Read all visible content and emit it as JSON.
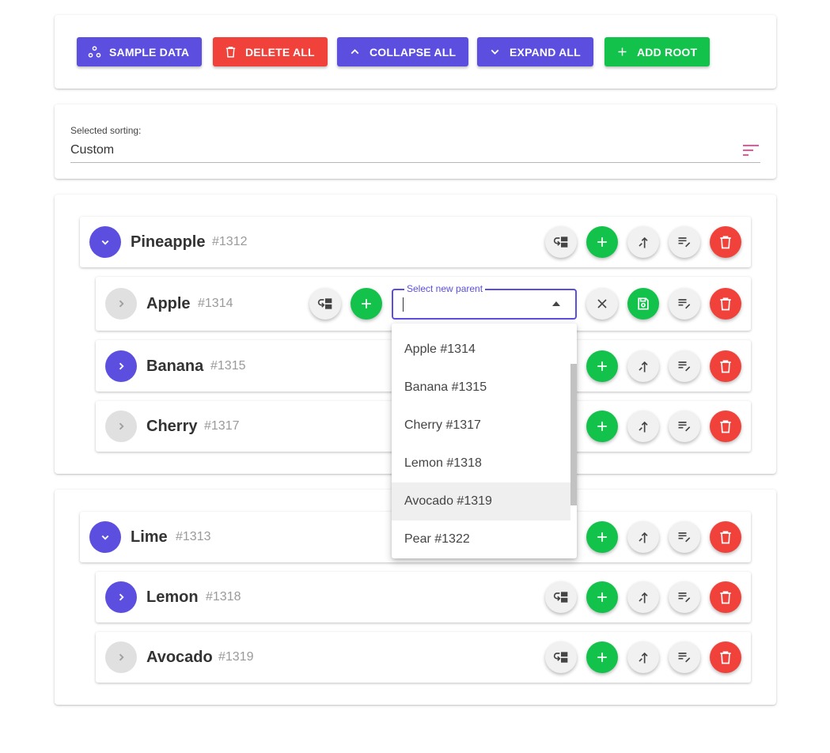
{
  "toolbar": {
    "buttons": [
      {
        "label": "SAMPLE DATA",
        "icon": "sample-data-icon",
        "color": "#5c4fe0"
      },
      {
        "label": "DELETE ALL",
        "icon": "trash-icon",
        "color": "#f0413b"
      },
      {
        "label": "COLLAPSE ALL",
        "icon": "chevron-up-icon",
        "color": "#5c4fe0"
      },
      {
        "label": "EXPAND ALL",
        "icon": "chevron-down-icon",
        "color": "#5c4fe0"
      },
      {
        "label": "ADD ROOT",
        "icon": "plus-icon",
        "color": "#13c24b"
      }
    ]
  },
  "sorting": {
    "label": "Selected sorting:",
    "value": "Custom"
  },
  "tree1": {
    "root": {
      "name": "Pineapple",
      "id": "#1312",
      "expanded": true
    },
    "children": [
      {
        "name": "Apple",
        "id": "#1314",
        "expanded": false
      },
      {
        "name": "Banana",
        "id": "#1315",
        "expanded": false
      },
      {
        "name": "Cherry",
        "id": "#1317",
        "expanded": false
      }
    ]
  },
  "tree2": {
    "root": {
      "name": "Lime",
      "id": "#1313",
      "expanded": true
    },
    "children": [
      {
        "name": "Lemon",
        "id": "#1318",
        "expanded": false
      },
      {
        "name": "Avocado",
        "id": "#1319",
        "expanded": false
      }
    ]
  },
  "parent_select": {
    "label": "Select new parent",
    "value": "",
    "options": [
      "Apple #1314",
      "Banana #1315",
      "Cherry #1317",
      "Lemon #1318",
      "Avocado #1319",
      "Pear #1322"
    ],
    "highlighted": "Avocado #1319"
  },
  "colors": {
    "primary": "#5c4fe0",
    "danger": "#f0413b",
    "success": "#13c24b",
    "sort_icon": "#e83e8c"
  }
}
